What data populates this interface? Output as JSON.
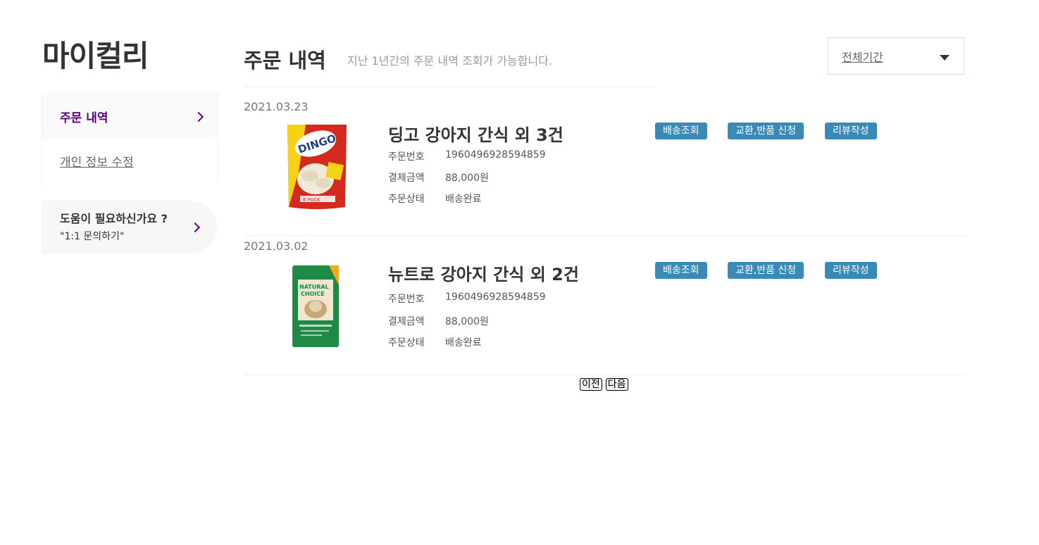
{
  "sidebar": {
    "title": "마이컬리",
    "items": [
      {
        "label": "주문 내역"
      },
      {
        "label": "개인 정보 수정"
      }
    ],
    "help": {
      "title": "도움이 필요하신가요 ?",
      "subtitle": "\"1:1 문의하기\""
    }
  },
  "main": {
    "title": "주문 내역",
    "description": "지난 1년간의 주문 내역 조회가 가능합니다.",
    "period_select": {
      "value": "전체기간"
    },
    "labels": {
      "order_number": "주문번호",
      "payment": "결제금액",
      "status": "주문상태"
    },
    "buttons": {
      "tracking": "배송조회",
      "exchange": "교환,반품 신청",
      "review": "리뷰작성"
    },
    "orders": [
      {
        "date": "2021.03.23",
        "product": "딩고 강아지 간식 외 3건",
        "order_number": "1960496928594859",
        "payment": "88,000원",
        "status": "배송완료",
        "thumb_colors": {
          "bag": "#d42a1e",
          "accent": "#f5d214",
          "text": "#1d3f8f"
        },
        "thumb_text": [
          "DINGO",
          "6 PACK"
        ]
      },
      {
        "date": "2021.03.02",
        "product": "뉴트로 강아지 간식 외 2건",
        "order_number": "1960496928594859",
        "payment": "88,000원",
        "status": "배송완료",
        "thumb_colors": {
          "bag": "#1f8a46",
          "accent": "#f0e6cf",
          "text": "#1f8a46"
        },
        "thumb_text": [
          "NATURAL",
          "CHOICE"
        ]
      }
    ],
    "pagination": {
      "prev": "이전",
      "next": "다음"
    }
  },
  "colors": {
    "brand_purple": "#5f0080",
    "button_blue": "#3a8ab7"
  }
}
